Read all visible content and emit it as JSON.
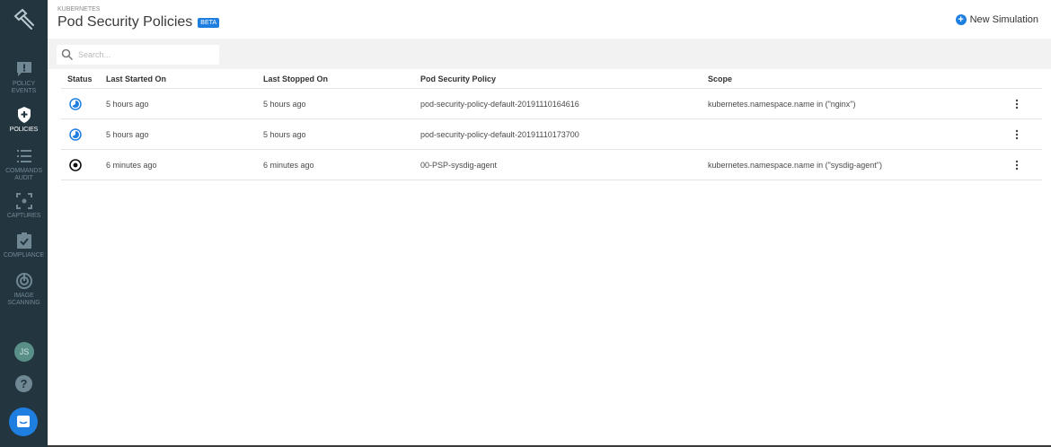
{
  "sidebar": {
    "items": [
      {
        "label": "POLICY EVENTS",
        "icon": "alert-icon"
      },
      {
        "label": "POLICIES",
        "icon": "shield-icon"
      },
      {
        "label": "COMMANDS AUDIT",
        "icon": "list-icon"
      },
      {
        "label": "CAPTURES",
        "icon": "capture-icon"
      },
      {
        "label": "COMPLIANCE",
        "icon": "checklist-icon"
      },
      {
        "label": "IMAGE SCANNING",
        "icon": "scan-icon"
      }
    ],
    "active": "POLICIES",
    "avatar_initials": "JS",
    "help_label": "?"
  },
  "header": {
    "breadcrumb": "KUBERNETES",
    "title": "Pod Security Policies",
    "badge": "BETA",
    "new_simulation_label": "New Simulation"
  },
  "search": {
    "placeholder": "Search..."
  },
  "table": {
    "columns": [
      "Status",
      "Last Started On",
      "Last Stopped On",
      "Pod Security Policy",
      "Scope"
    ],
    "rows": [
      {
        "status": "running",
        "started": "5 hours ago",
        "stopped": "5 hours ago",
        "policy": "pod-security-policy-default-20191110164616",
        "scope": "kubernetes.namespace.name in (\"nginx\")"
      },
      {
        "status": "running",
        "started": "5 hours ago",
        "stopped": "5 hours ago",
        "policy": "pod-security-policy-default-20191110173700",
        "scope": ""
      },
      {
        "status": "stopped",
        "started": "6 minutes ago",
        "stopped": "6 minutes ago",
        "policy": "00-PSP-sysdig-agent",
        "scope": "kubernetes.namespace.name in (\"sysdig-agent\")"
      }
    ]
  },
  "colors": {
    "sidebar_bg": "#23353f",
    "accent": "#1f7fe0",
    "toolbar_bg": "#f2f2f2"
  }
}
